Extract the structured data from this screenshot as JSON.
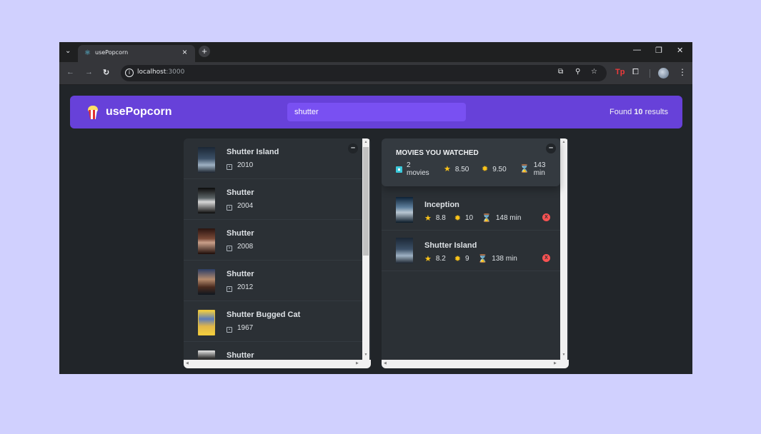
{
  "browser": {
    "tab_title": "usePopcorn",
    "url_host": "localhost",
    "url_port": ":3000"
  },
  "app": {
    "logo_text": "usePopcorn",
    "search_value": "shutter",
    "results_prefix": "Found ",
    "results_count": "10",
    "results_suffix": " results"
  },
  "movies": [
    {
      "title": "Shutter Island",
      "year": "2010"
    },
    {
      "title": "Shutter",
      "year": "2004"
    },
    {
      "title": "Shutter",
      "year": "2008"
    },
    {
      "title": "Shutter",
      "year": "2012"
    },
    {
      "title": "Shutter Bugged Cat",
      "year": "1967"
    },
    {
      "title": "Shutter",
      "year": ""
    }
  ],
  "summary": {
    "heading": "MOVIES YOU WATCHED",
    "count": "2",
    "count_label": "movies",
    "avg_imdb": "8.50",
    "avg_user": "9.50",
    "avg_runtime": "143",
    "runtime_label": "min"
  },
  "watched": [
    {
      "title": "Inception",
      "imdb": "8.8",
      "user": "10",
      "runtime": "148 min"
    },
    {
      "title": "Shutter Island",
      "imdb": "8.2",
      "user": "9",
      "runtime": "138 min"
    }
  ],
  "colors": {
    "navbar": "#6741d9",
    "search": "#7950f2",
    "box": "#2b3035",
    "background": "#212529",
    "delete": "#fa5252"
  }
}
